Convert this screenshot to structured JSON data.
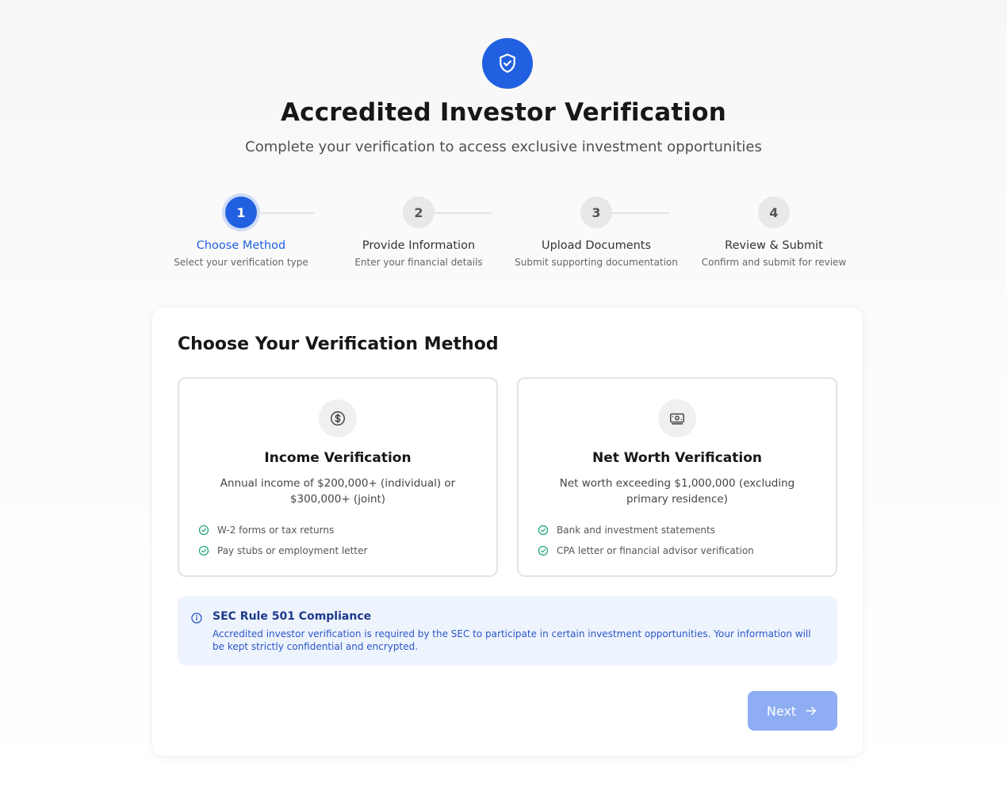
{
  "header": {
    "icon": "shield-check-icon",
    "title": "Accredited Investor Verification",
    "subtitle": "Complete your verification to access exclusive investment opportunities"
  },
  "stepper": {
    "current_step": 1,
    "steps": [
      {
        "number": "1",
        "label": "Choose Method",
        "description": "Select your verification type"
      },
      {
        "number": "2",
        "label": "Provide Information",
        "description": "Enter your financial details"
      },
      {
        "number": "3",
        "label": "Upload Documents",
        "description": "Submit supporting documentation"
      },
      {
        "number": "4",
        "label": "Review & Submit",
        "description": "Confirm and submit for review"
      }
    ]
  },
  "main": {
    "title": "Choose Your Verification Method",
    "methods": [
      {
        "icon": "dollar-circle-icon",
        "title": "Income Verification",
        "description": "Annual income of $200,000+ (individual) or $300,000+ (joint)",
        "requirements": [
          "W-2 forms or tax returns",
          "Pay stubs or employment letter"
        ]
      },
      {
        "icon": "banknote-icon",
        "title": "Net Worth Verification",
        "description": "Net worth exceeding $1,000,000 (excluding primary residence)",
        "requirements": [
          "Bank and investment statements",
          "CPA letter or financial advisor verification"
        ]
      }
    ],
    "notice": {
      "icon": "info-icon",
      "title": "SEC Rule 501 Compliance",
      "text": "Accredited investor verification is required by the SEC to participate in certain investment opportunities. Your information will be kept strictly confidential and encrypted."
    },
    "next_button": {
      "label": "Next",
      "icon": "arrow-right-icon"
    }
  },
  "colors": {
    "primary": "#2160e0",
    "primary_disabled": "#8eadf3",
    "success": "#1aa37a",
    "notice_bg": "#eef4fe",
    "notice_title": "#1e3a8a"
  }
}
